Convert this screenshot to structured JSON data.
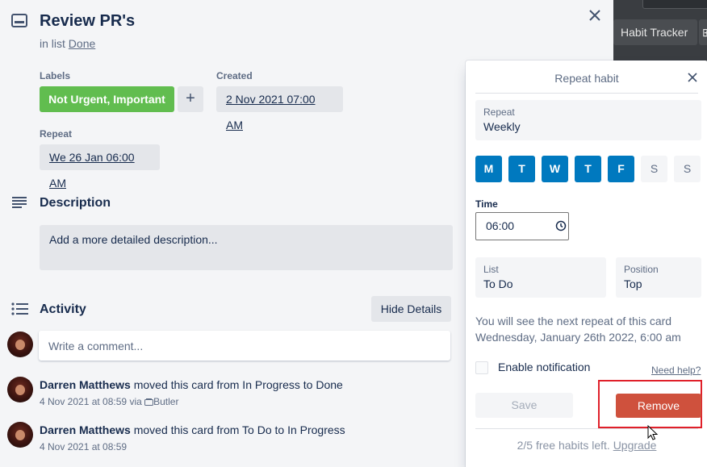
{
  "background": {
    "chip_label": "Habit Tracker",
    "chip2_label": "⊞"
  },
  "card": {
    "title": "Review PR's",
    "in_list_prefix": "in list",
    "list_name": "Done",
    "labels_heading": "Labels",
    "label_text": "Not Urgent, Important",
    "label_color": "#61bd4f",
    "add_label": "+",
    "created_heading": "Created",
    "created_value": "2 Nov 2021 07:00 AM",
    "repeat_heading": "Repeat",
    "repeat_value": "We 26 Jan 06:00 AM",
    "description_heading": "Description",
    "description_placeholder": "Add a more detailed description...",
    "activity_heading": "Activity",
    "hide_details": "Hide Details",
    "comment_placeholder": "Write a comment...",
    "activity": [
      {
        "user": "Darren Matthews",
        "action": "moved this card from In Progress to Done",
        "time": "4 Nov 2021 at 08:59",
        "via": "via",
        "via_app": "Butler"
      },
      {
        "user": "Darren Matthews",
        "action": "moved this card from To Do to In Progress",
        "time": "4 Nov 2021 at 08:59"
      }
    ]
  },
  "popover": {
    "title": "Repeat habit",
    "repeat_label": "Repeat",
    "repeat_value": "Weekly",
    "days": [
      {
        "label": "M",
        "on": true
      },
      {
        "label": "T",
        "on": true
      },
      {
        "label": "W",
        "on": true
      },
      {
        "label": "T",
        "on": true
      },
      {
        "label": "F",
        "on": true
      },
      {
        "label": "S",
        "on": false
      },
      {
        "label": "S",
        "on": false
      }
    ],
    "time_label": "Time",
    "time_value": "06:00",
    "list_label": "List",
    "list_value": "To Do",
    "position_label": "Position",
    "position_value": "Top",
    "note_line1": "You will see the next repeat of this card",
    "note_line2": "Wednesday, January 26th 2022, 6:00 am",
    "notification_label": "Enable notification",
    "help_link": "Need help?",
    "save_label": "Save",
    "remove_label": "Remove",
    "remove_color": "#cf513d",
    "accent_color": "#0079bf",
    "footer_text": "2/5 free habits left.",
    "upgrade_link": "Upgrade"
  }
}
